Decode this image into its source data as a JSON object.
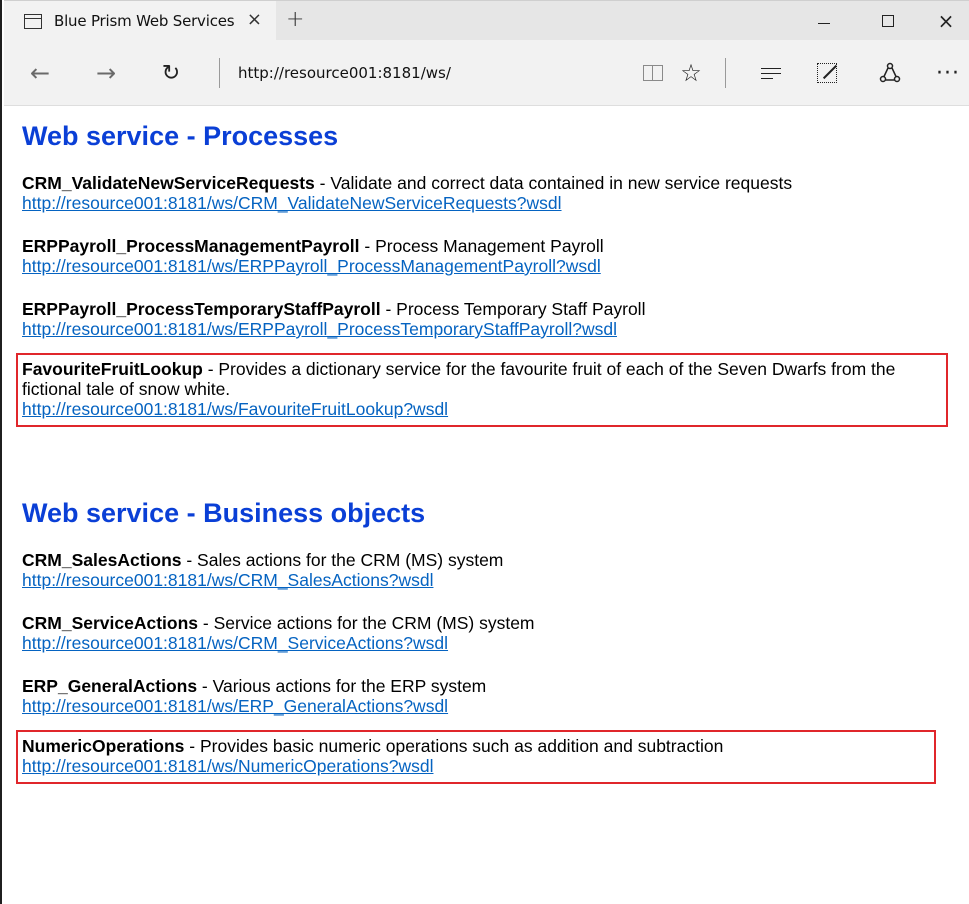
{
  "browser": {
    "tab_title": "Blue Prism Web Services",
    "tab_close_icon": "×",
    "new_tab_icon": "+",
    "min_label": "",
    "close_icon": "×",
    "back_icon": "←",
    "forward_icon": "→",
    "refresh_icon": "↻",
    "address": "http://resource001:8181/ws/",
    "favorite_icon": "☆",
    "share_icon": "⌂",
    "more_icon": "···"
  },
  "processes": {
    "heading": "Web service - Processes",
    "items": [
      {
        "name": "CRM_ValidateNewServiceRequests",
        "desc": " - Validate and correct data contained in new service requests",
        "url": "http://resource001:8181/ws/CRM_ValidateNewServiceRequests?wsdl"
      },
      {
        "name": "ERPPayroll_ProcessManagementPayroll",
        "desc": " - Process Management Payroll",
        "url": "http://resource001:8181/ws/ERPPayroll_ProcessManagementPayroll?wsdl"
      },
      {
        "name": "ERPPayroll_ProcessTemporaryStaffPayroll",
        "desc": " - Process Temporary Staff Payroll",
        "url": "http://resource001:8181/ws/ERPPayroll_ProcessTemporaryStaffPayroll?wsdl"
      },
      {
        "name": "FavouriteFruitLookup",
        "desc": " - Provides a dictionary service for the favourite fruit of each of the Seven Dwarfs from the fictional tale of snow white.",
        "url": "http://resource001:8181/ws/FavouriteFruitLookup?wsdl"
      }
    ]
  },
  "business_objects": {
    "heading": "Web service - Business objects",
    "items": [
      {
        "name": "CRM_SalesActions",
        "desc": " - Sales actions for the CRM (MS) system",
        "url": "http://resource001:8181/ws/CRM_SalesActions?wsdl"
      },
      {
        "name": "CRM_ServiceActions",
        "desc": " - Service actions for the CRM (MS) system",
        "url": "http://resource001:8181/ws/CRM_ServiceActions?wsdl"
      },
      {
        "name": "ERP_GeneralActions",
        "desc": " - Various actions for the ERP system",
        "url": "http://resource001:8181/ws/ERP_GeneralActions?wsdl"
      },
      {
        "name": "NumericOperations",
        "desc": " - Provides basic numeric operations such as addition and subtraction",
        "url": "http://resource001:8181/ws/NumericOperations?wsdl"
      }
    ]
  },
  "colors": {
    "heading": "#0a3fd6",
    "link": "#0563c1",
    "highlight_box": "#e0262b"
  }
}
